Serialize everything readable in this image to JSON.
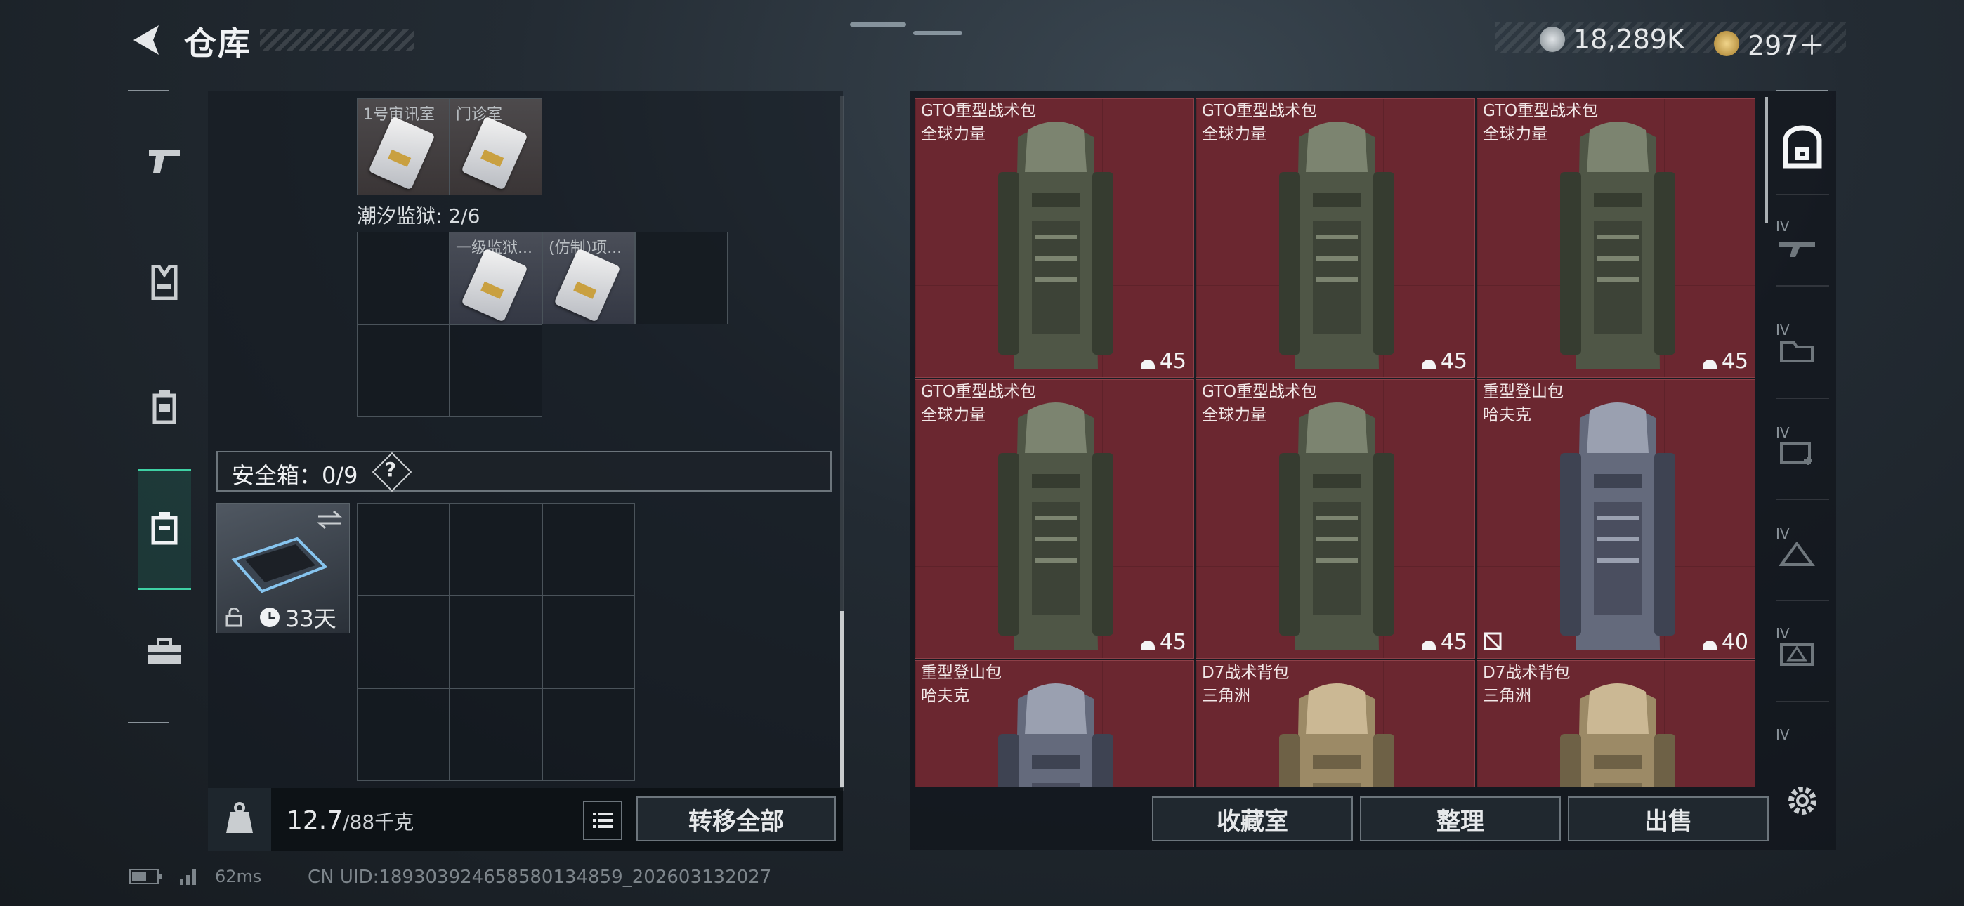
{
  "header": {
    "title": "仓库"
  },
  "currency": {
    "primary": "18,289K",
    "secondary": "297＋"
  },
  "storage": {
    "top_row_labels": [
      "1号审讯室",
      "门诊室"
    ],
    "prison_label": "潮汐监狱: 2/6",
    "prison_items": [
      "一级监狱...",
      "(仿制)项..."
    ],
    "safebox_label": "安全箱：0/9",
    "safebox_help": "?",
    "safebox_days": "33天",
    "weight_value": "12.7",
    "weight_capacity": "/88千克",
    "transfer_button": "转移全部"
  },
  "inventory": {
    "items": [
      {
        "name": "GTO重型战术包",
        "brand": "全球力量",
        "capacity": "45",
        "color": "green"
      },
      {
        "name": "GTO重型战术包",
        "brand": "全球力量",
        "capacity": "45",
        "color": "green"
      },
      {
        "name": "GTO重型战术包",
        "brand": "全球力量",
        "capacity": "45",
        "color": "green"
      },
      {
        "name": "GTO重型战术包",
        "brand": "全球力量",
        "capacity": "45",
        "color": "green"
      },
      {
        "name": "GTO重型战术包",
        "brand": "全球力量",
        "capacity": "45",
        "color": "green"
      },
      {
        "name": "重型登山包",
        "brand": "哈夫克",
        "capacity": "40",
        "color": "gray"
      },
      {
        "name": "重型登山包",
        "brand": "哈夫克",
        "capacity": "",
        "color": "gray"
      },
      {
        "name": "D7战术背包",
        "brand": "三角洲",
        "capacity": "",
        "color": "tan"
      },
      {
        "name": "D7战术背包",
        "brand": "三角洲",
        "capacity": "",
        "color": "tan"
      }
    ],
    "buttons": {
      "collection": "收藏室",
      "sort": "整理",
      "sell": "出售"
    }
  },
  "right_nav": {
    "tier_labels": [
      "IV",
      "IV",
      "IV",
      "IV",
      "IV",
      "IV"
    ]
  },
  "status": {
    "ping": "62ms",
    "uid": "CN UID:18930392465858013485​9_202603132027"
  },
  "colors": {
    "accent": "#3ed1a4",
    "slot_bg": "#6b2730"
  }
}
